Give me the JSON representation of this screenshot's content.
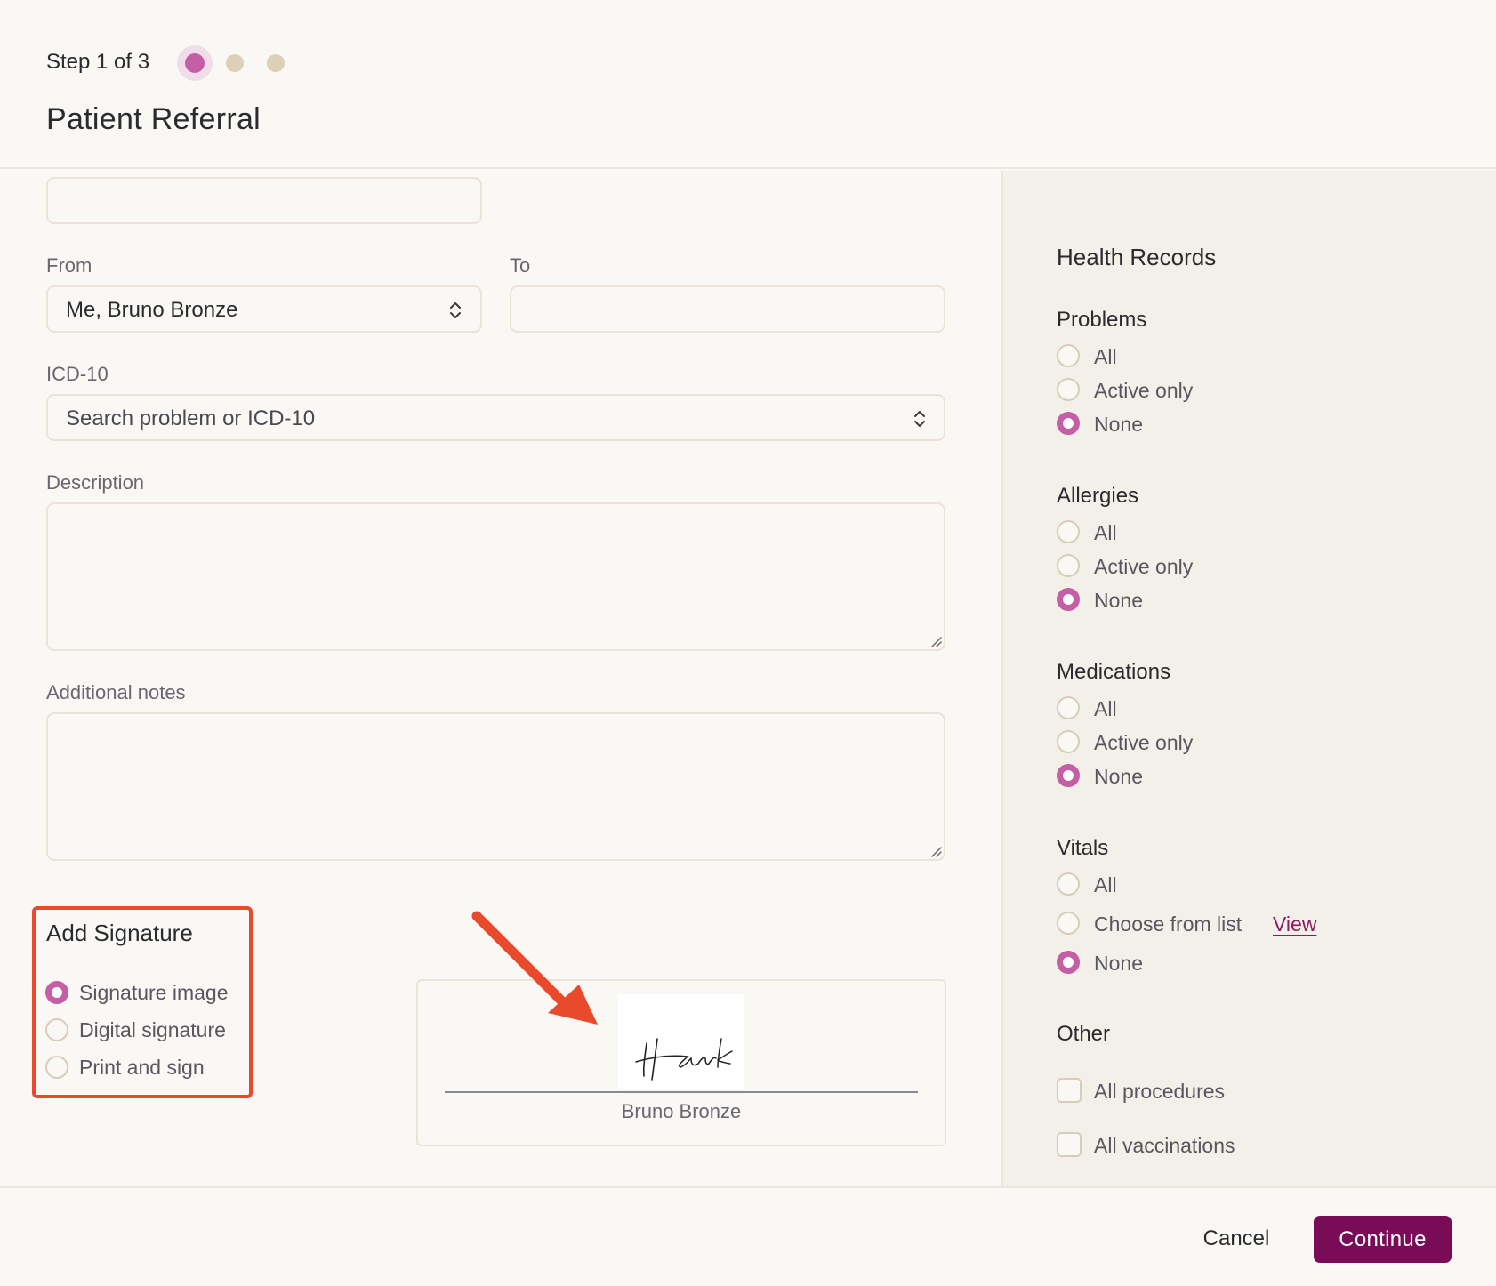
{
  "header": {
    "step_text": "Step 1 of 3",
    "title": "Patient Referral",
    "step_total": 3,
    "step_current": 1
  },
  "form": {
    "top_input_value": "",
    "from_label": "From",
    "from_value": "Me, Bruno Bronze",
    "to_label": "To",
    "to_value": "",
    "icd_label": "ICD-10",
    "icd_placeholder": "Search problem or ICD-10",
    "description_label": "Description",
    "description_value": "",
    "notes_label": "Additional notes",
    "notes_value": ""
  },
  "signature": {
    "title": "Add Signature",
    "options": [
      {
        "label": "Signature image",
        "checked": true
      },
      {
        "label": "Digital signature",
        "checked": false
      },
      {
        "label": "Print and sign",
        "checked": false
      }
    ],
    "signer_name": "Bruno Bronze",
    "signature_image_text": "Hank"
  },
  "health_records": {
    "title": "Health Records",
    "groups": {
      "problems": {
        "title": "Problems",
        "options": [
          "All",
          "Active only",
          "None"
        ],
        "selected": "None"
      },
      "allergies": {
        "title": "Allergies",
        "options": [
          "All",
          "Active only",
          "None"
        ],
        "selected": "None"
      },
      "medications": {
        "title": "Medications",
        "options": [
          "All",
          "Active only",
          "None"
        ],
        "selected": "None"
      },
      "vitals": {
        "title": "Vitals",
        "options": [
          "All",
          "Choose from list",
          "None"
        ],
        "selected": "None",
        "view_link": "View"
      }
    },
    "other": {
      "title": "Other",
      "items": [
        {
          "label": "All procedures",
          "checked": false
        },
        {
          "label": "All vaccinations",
          "checked": false
        }
      ]
    }
  },
  "footer": {
    "cancel_label": "Cancel",
    "continue_label": "Continue"
  },
  "colors": {
    "accent": "#c45fa6",
    "primary_button": "#7a0b56",
    "highlight_border": "#ea4a2c",
    "annotation_arrow": "#ea4a2c"
  },
  "icons": [
    "chevron-updown-icon",
    "resize-handle-icon",
    "annotation-arrow-icon"
  ]
}
